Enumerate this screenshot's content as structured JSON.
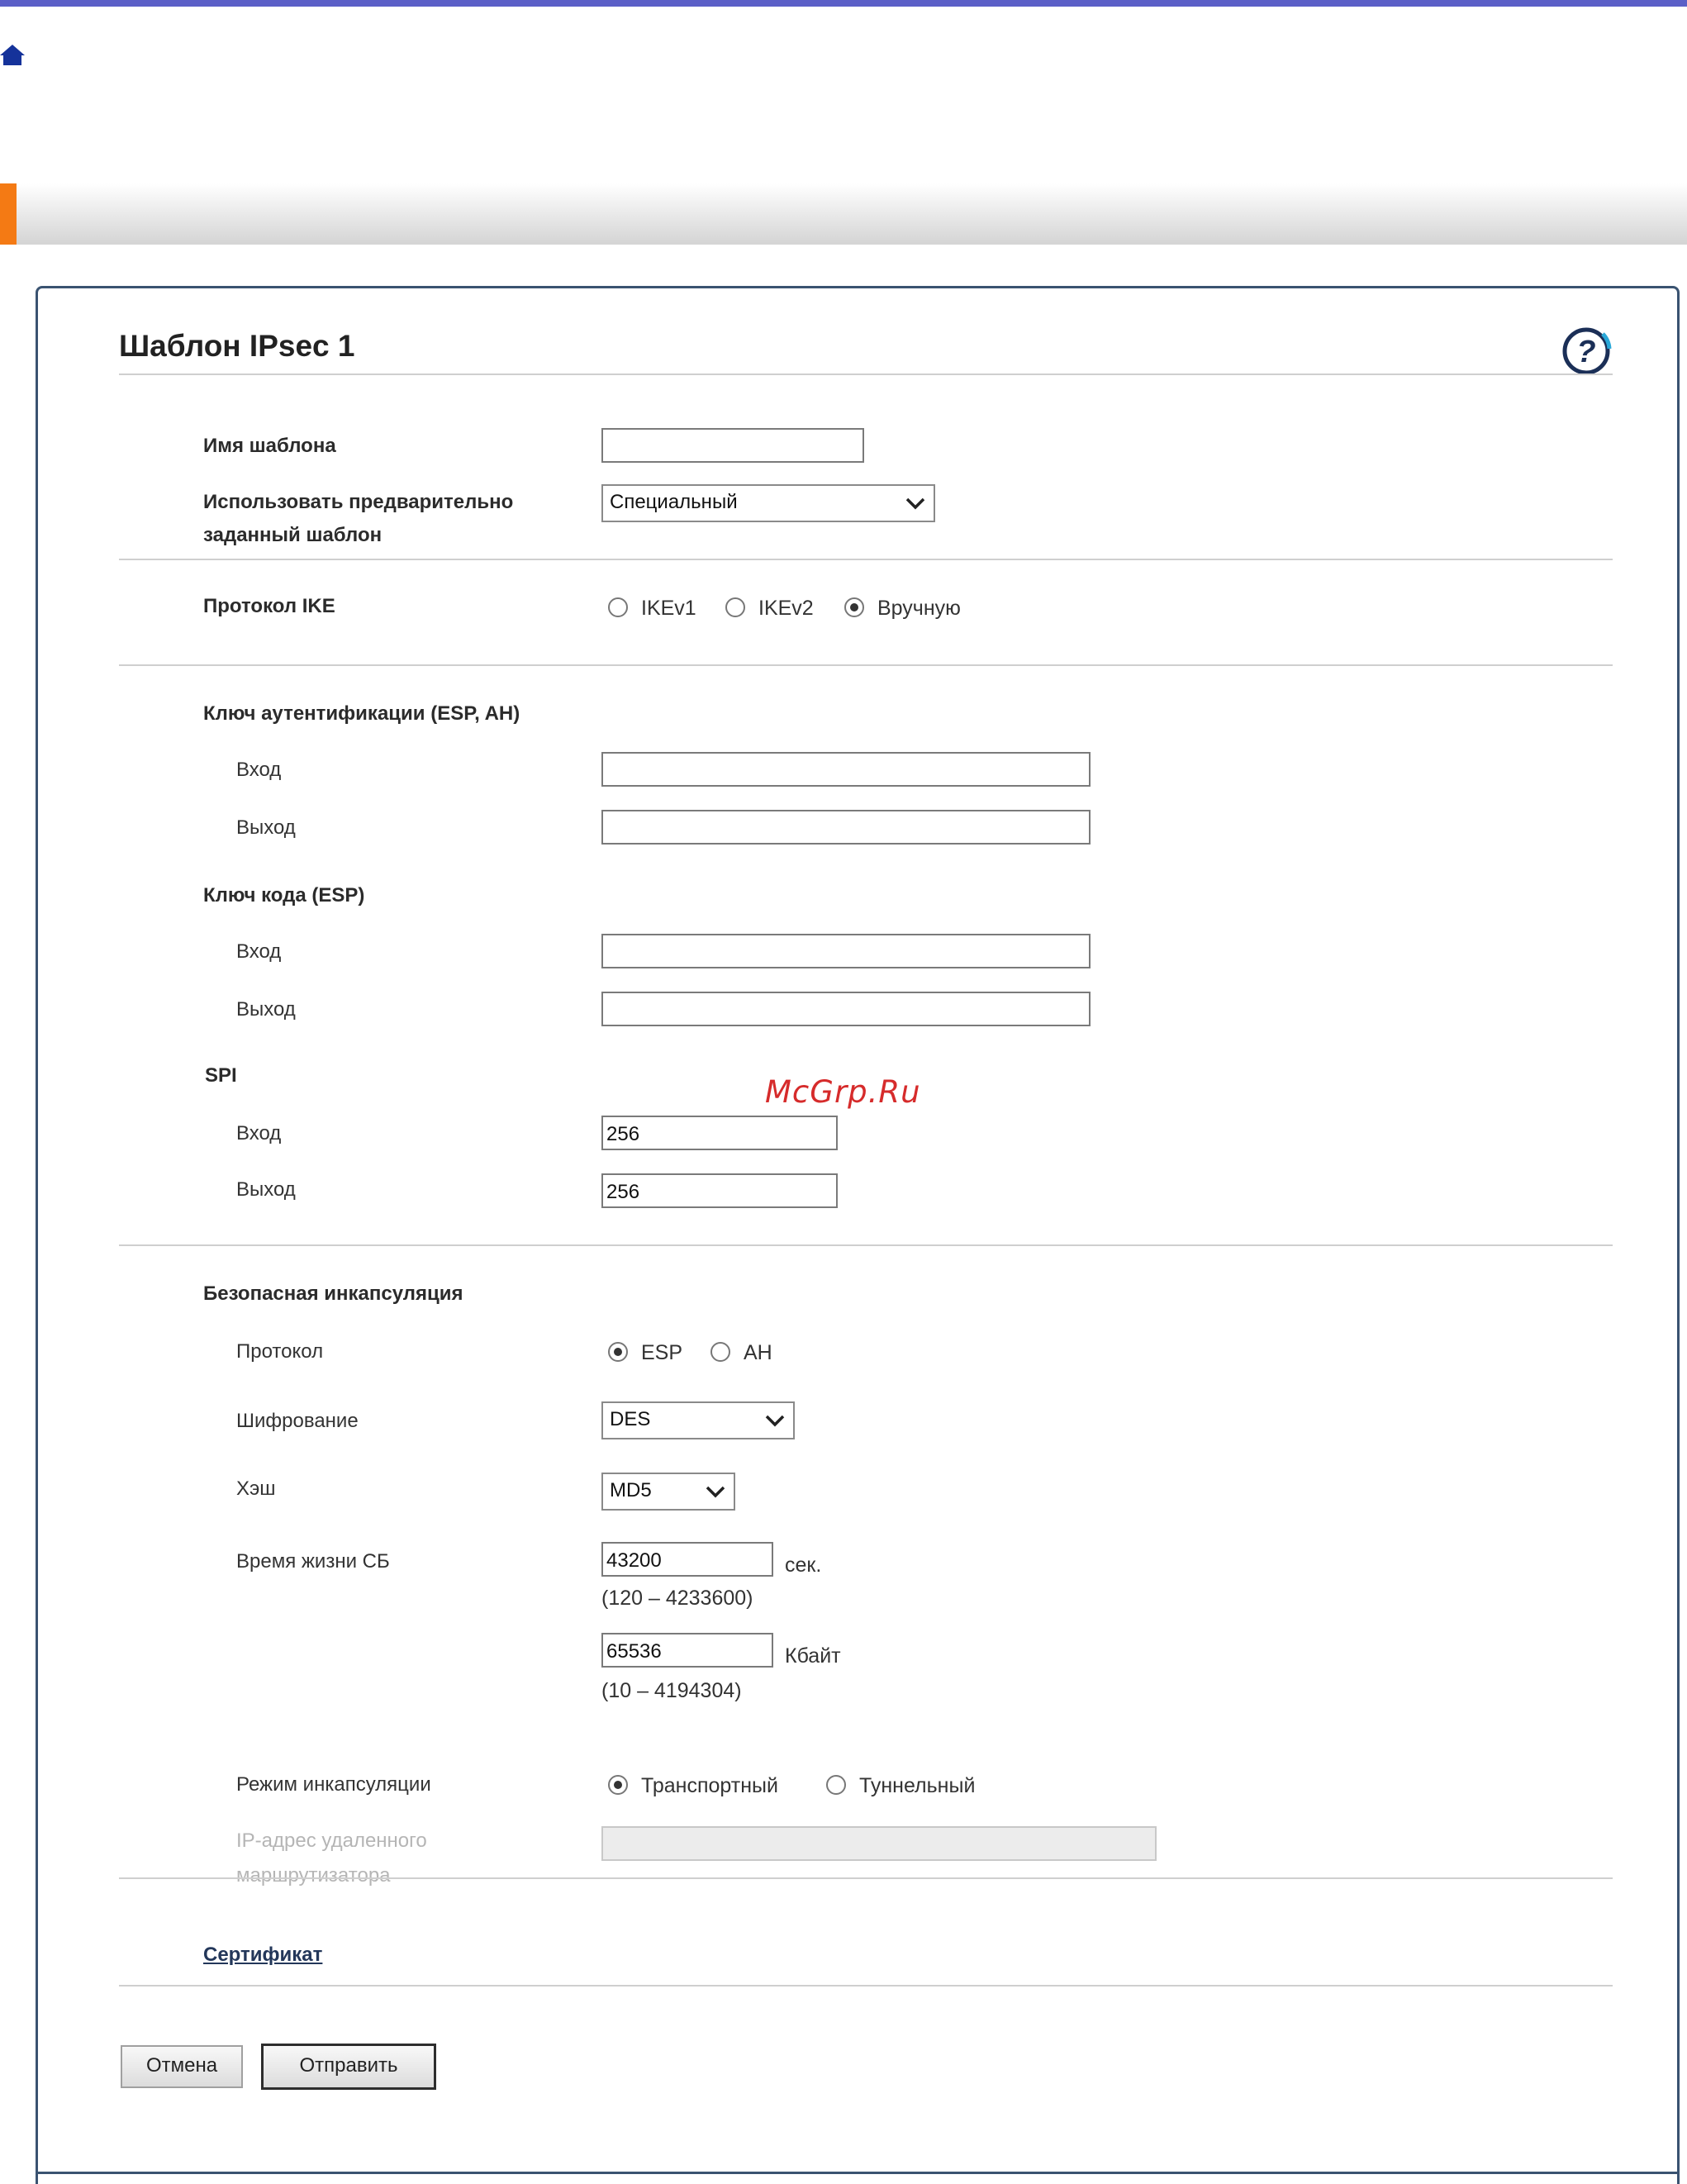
{
  "header": {
    "home_icon": "home-icon",
    "accent_color": "#f47a14",
    "bar_color": "#5b5fc7"
  },
  "page": {
    "title": "Шаблон IPsec 1",
    "help_icon": "help-icon"
  },
  "template_name": {
    "label": "Имя шаблона",
    "value": ""
  },
  "predefined": {
    "label_line1": "Использовать предварительно",
    "label_line2": "заданный шаблон",
    "value": "Специальный"
  },
  "ike": {
    "label": "Протокол IKE",
    "options": [
      "IKEv1",
      "IKEv2",
      "Вручную"
    ],
    "selected": "Вручную"
  },
  "auth_key": {
    "label": "Ключ аутентификации (ESP, AH)",
    "in_label": "Вход",
    "in_value": "",
    "out_label": "Выход",
    "out_value": ""
  },
  "code_key": {
    "label": "Ключ кода (ESP)",
    "in_label": "Вход",
    "in_value": "",
    "out_label": "Выход",
    "out_value": ""
  },
  "spi": {
    "label": "SPI",
    "in_label": "Вход",
    "in_value": "256",
    "out_label": "Выход",
    "out_value": "256"
  },
  "watermark": "McGrp.Ru",
  "encap": {
    "label": "Безопасная инкапсуляция",
    "protocol_label": "Протокол",
    "protocol_options": [
      "ESP",
      "AH"
    ],
    "protocol_selected": "ESP",
    "encryption_label": "Шифрование",
    "encryption_value": "DES",
    "hash_label": "Хэш",
    "hash_value": "MD5",
    "lifetime_label": "Время жизни СБ",
    "lifetime_sec_value": "43200",
    "lifetime_sec_unit": "сек.",
    "lifetime_sec_range": "(120 – 4233600)",
    "lifetime_kb_value": "65536",
    "lifetime_kb_unit": "Кбайт",
    "lifetime_kb_range": "(10 – 4194304)",
    "mode_label": "Режим инкапсуляции",
    "mode_options": [
      "Транспортный",
      "Туннельный"
    ],
    "mode_selected": "Транспортный",
    "router_label_line1": "IP-адрес удаленного",
    "router_label_line2": "маршрутизатора",
    "router_value": ""
  },
  "certificate_link": "Сертификат",
  "buttons": {
    "cancel": "Отмена",
    "submit": "Отправить"
  }
}
